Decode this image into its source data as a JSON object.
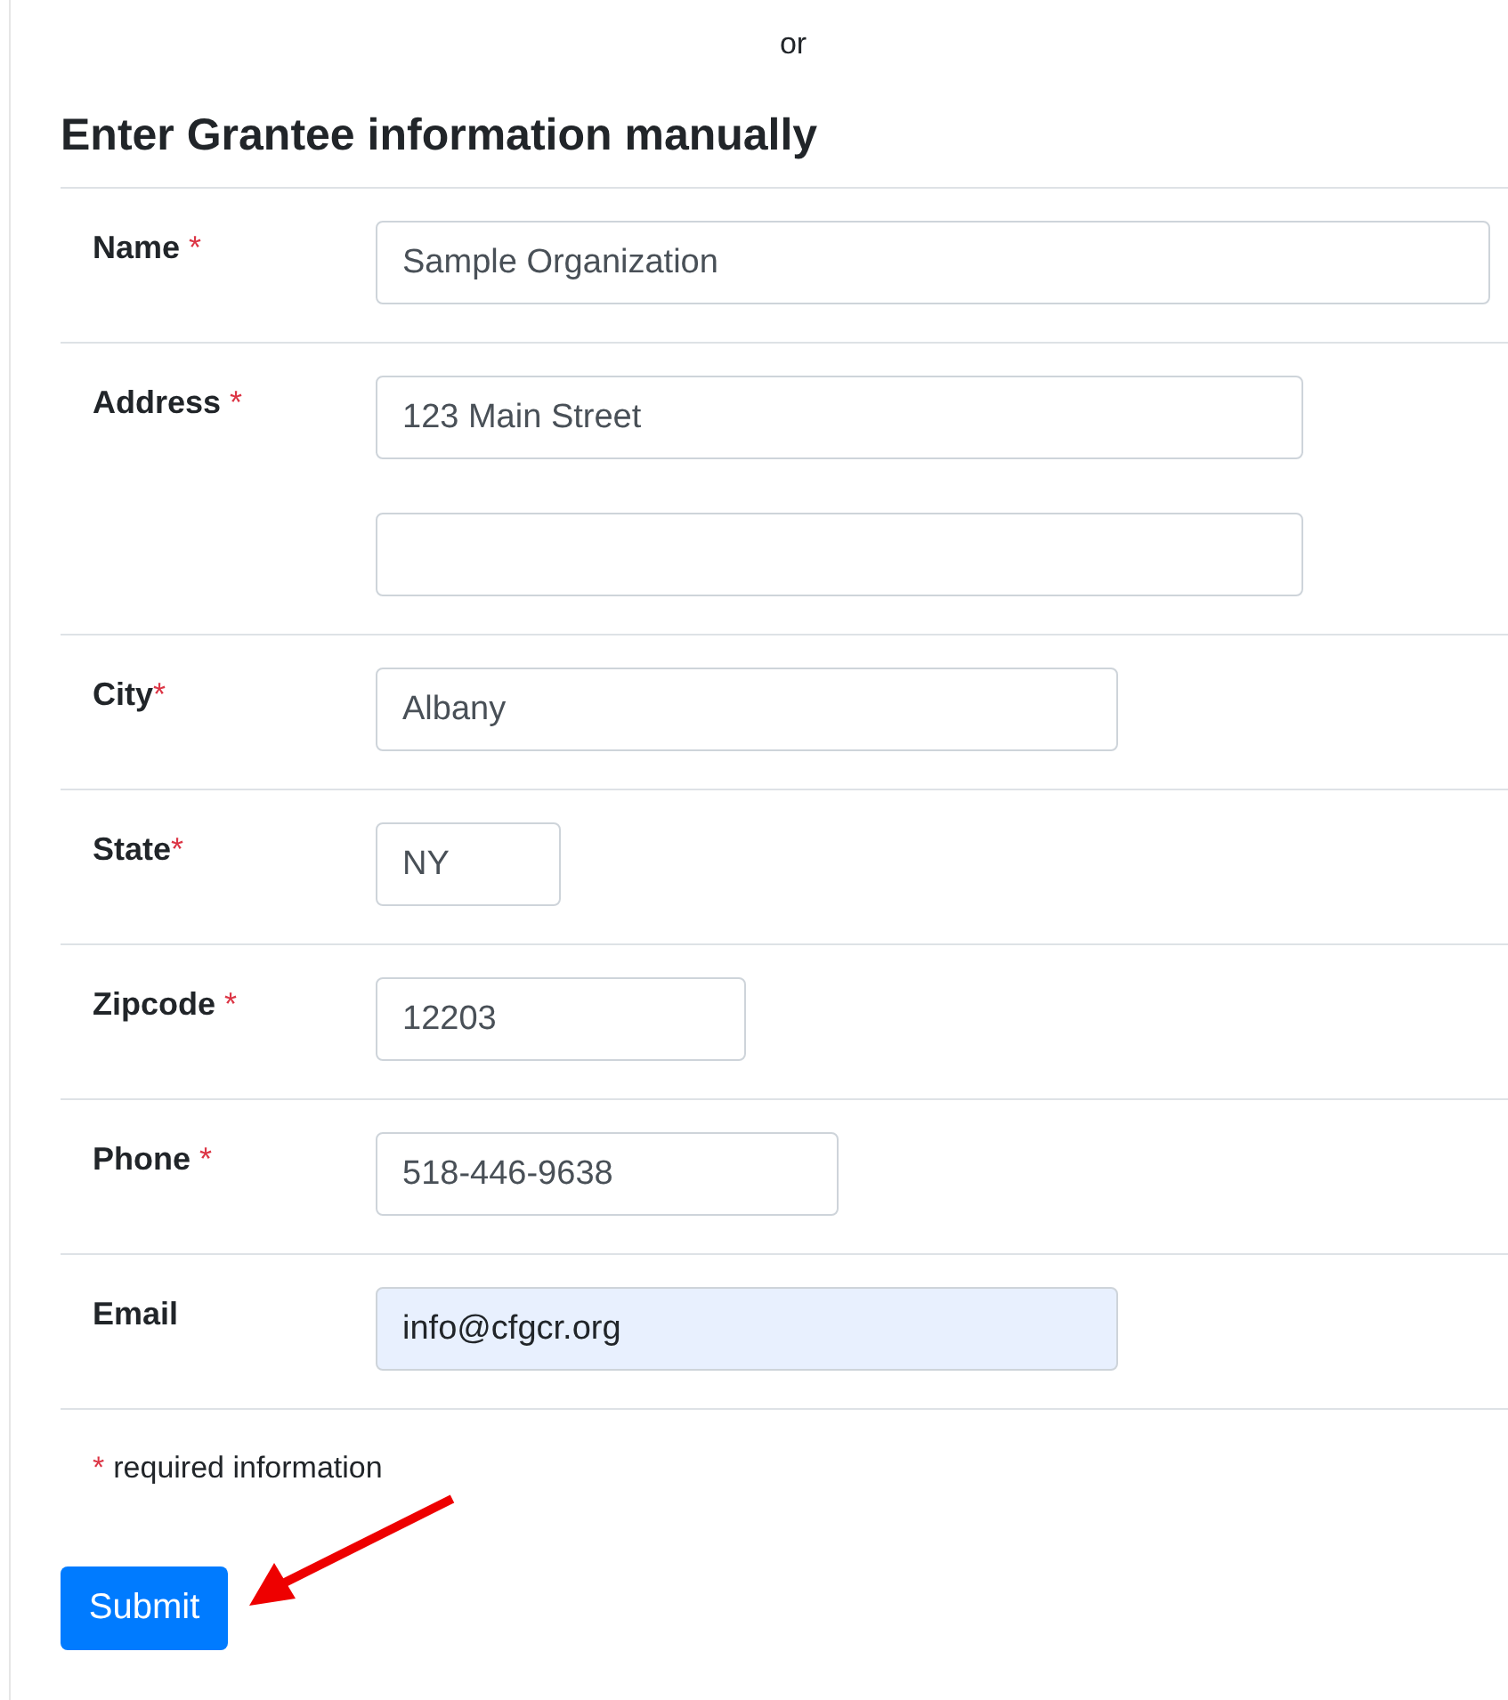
{
  "separator": "or",
  "heading": "Enter Grantee information manually",
  "fields": [
    {
      "label": "Name",
      "mark": "*",
      "mark_spaced": true,
      "inputs": [
        {
          "value": "Sample Organization",
          "autofilled": false
        }
      ]
    },
    {
      "label": "Address",
      "mark": "*",
      "mark_spaced": true,
      "inputs": [
        {
          "value": "123 Main Street",
          "autofilled": false
        },
        {
          "autofilled": false
        }
      ]
    },
    {
      "label": "City",
      "mark": "*",
      "mark_spaced": false,
      "inputs": [
        {
          "value": "Albany",
          "autofilled": false
        }
      ]
    },
    {
      "label": "State",
      "mark": "*",
      "mark_spaced": false,
      "inputs": [
        {
          "value": "NY",
          "autofilled": false
        }
      ]
    },
    {
      "label": "Zipcode",
      "mark": "*",
      "mark_spaced": true,
      "inputs": [
        {
          "value": "12203",
          "autofilled": false
        }
      ]
    },
    {
      "label": "Phone",
      "mark": "*",
      "mark_spaced": true,
      "inputs": [
        {
          "value": "518-446-9638",
          "autofilled": false
        }
      ]
    },
    {
      "label": "Email",
      "inputs": [
        {
          "value": "info@cfgcr.org",
          "autofilled": true
        }
      ]
    }
  ],
  "footnote": {
    "mark": "*",
    "text": "required information"
  },
  "submit": "Submit",
  "annotations": [
    {
      "kind": "arrow",
      "color": "#ee0000"
    }
  ]
}
